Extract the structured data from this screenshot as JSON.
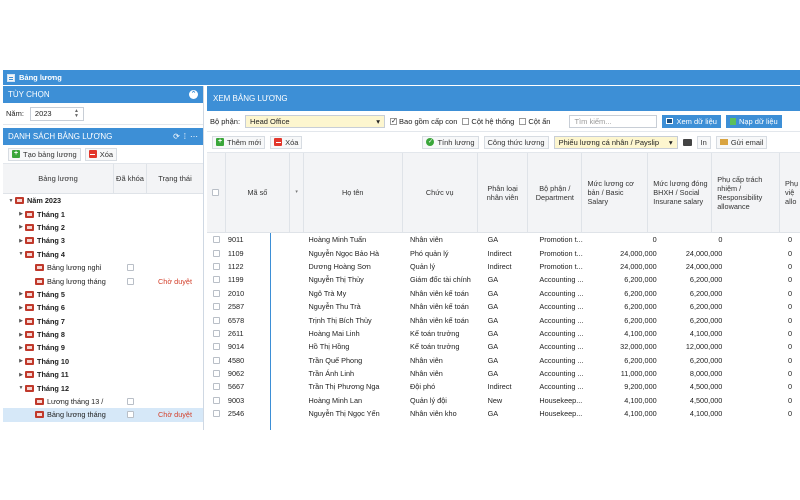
{
  "window": {
    "title": "Bảng lương"
  },
  "left_panel": {
    "options_title": "TÙY CHỌN",
    "year_label": "Năm:",
    "year_value": "2023",
    "list_title": "DANH SÁCH BẢNG LƯƠNG",
    "create_label": "Tạo bảng lương",
    "delete_label": "Xóa",
    "columns": [
      "Bảng lương",
      "Đã khóa",
      "Trạng thái"
    ],
    "tree": [
      {
        "label": "Năm 2023",
        "level": 0,
        "arrow": "down",
        "bold": true,
        "folder": true,
        "checkbox": false,
        "status": ""
      },
      {
        "label": "Tháng 1",
        "level": 1,
        "arrow": "right",
        "bold": true,
        "folder": true,
        "checkbox": false,
        "status": ""
      },
      {
        "label": "Tháng 2",
        "level": 1,
        "arrow": "right",
        "bold": true,
        "folder": true,
        "checkbox": false,
        "status": ""
      },
      {
        "label": "Tháng 3",
        "level": 1,
        "arrow": "right",
        "bold": true,
        "folder": true,
        "checkbox": false,
        "status": ""
      },
      {
        "label": "Tháng 4",
        "level": 1,
        "arrow": "down",
        "bold": true,
        "folder": true,
        "checkbox": false,
        "status": ""
      },
      {
        "label": "Bảng lương nghỉ",
        "level": 2,
        "arrow": "",
        "bold": false,
        "folder": true,
        "checkbox": true,
        "status": ""
      },
      {
        "label": "Bảng lương tháng",
        "level": 2,
        "arrow": "",
        "bold": false,
        "folder": true,
        "checkbox": true,
        "status": "Chờ duyệt"
      },
      {
        "label": "Tháng 5",
        "level": 1,
        "arrow": "right",
        "bold": true,
        "folder": true,
        "checkbox": false,
        "status": ""
      },
      {
        "label": "Tháng 6",
        "level": 1,
        "arrow": "right",
        "bold": true,
        "folder": true,
        "checkbox": false,
        "status": ""
      },
      {
        "label": "Tháng 7",
        "level": 1,
        "arrow": "right",
        "bold": true,
        "folder": true,
        "checkbox": false,
        "status": ""
      },
      {
        "label": "Tháng 8",
        "level": 1,
        "arrow": "right",
        "bold": true,
        "folder": true,
        "checkbox": false,
        "status": ""
      },
      {
        "label": "Tháng 9",
        "level": 1,
        "arrow": "right",
        "bold": true,
        "folder": true,
        "checkbox": false,
        "status": ""
      },
      {
        "label": "Tháng 10",
        "level": 1,
        "arrow": "right",
        "bold": true,
        "folder": true,
        "checkbox": false,
        "status": ""
      },
      {
        "label": "Tháng 11",
        "level": 1,
        "arrow": "right",
        "bold": true,
        "folder": true,
        "checkbox": false,
        "status": ""
      },
      {
        "label": "Tháng 12",
        "level": 1,
        "arrow": "down",
        "bold": true,
        "folder": true,
        "checkbox": false,
        "status": ""
      },
      {
        "label": "Lương tháng 13 /",
        "level": 2,
        "arrow": "",
        "bold": false,
        "folder": true,
        "checkbox": true,
        "status": ""
      },
      {
        "label": "Bảng lương tháng",
        "level": 2,
        "arrow": "",
        "bold": false,
        "folder": true,
        "checkbox": true,
        "status": "Chờ duyệt",
        "selected": true
      }
    ]
  },
  "right_panel": {
    "title": "XEM BẢNG LƯƠNG",
    "dept_label": "Bộ phận:",
    "dept_value": "Head Office",
    "include_children_label": "Bao gồm cấp con",
    "include_children_checked": true,
    "system_cols_label": "Cột hệ thống",
    "hidden_cols_label": "Cột ẩn",
    "search_placeholder": "Tìm kiếm...",
    "view_data_label": "Xem dữ liệu",
    "load_data_label": "Nạp dữ liệu",
    "add_label": "Thêm mới",
    "delete_label": "Xóa",
    "calc_label": "Tính lương",
    "formula_label": "Công thức lương",
    "payslip_value": "Phiếu lương cá nhân / Payslip",
    "print_label": "In",
    "email_label": "Gửi email",
    "columns": [
      "Mã số",
      "Họ tên",
      "Chức vụ",
      "Phân loại nhân viên",
      "Bộ phận / Department",
      "Mức lương cơ bản / Basic Salary",
      "Mức lương đóng BHXH / Social Insurane salary",
      "Phụ cấp trách nhiệm / Responsibility allowance",
      "Phụ việ allo"
    ],
    "rows": [
      {
        "code": "9011",
        "name": "Hoàng Minh Tuấn",
        "position": "Nhân viên",
        "type": "GA",
        "dept": "Promotion t...",
        "basic": "0",
        "insurance": "0",
        "allowance": "0"
      },
      {
        "code": "1109",
        "name": "Nguyễn Ngọc Bảo Hà",
        "position": "Phó quản lý",
        "type": "Indirect",
        "dept": "Promotion t...",
        "basic": "24,000,000",
        "insurance": "24,000,000",
        "allowance": "0"
      },
      {
        "code": "1122",
        "name": "Dương Hoàng Sơn",
        "position": "Quản lý",
        "type": "Indirect",
        "dept": "Promotion t...",
        "basic": "24,000,000",
        "insurance": "24,000,000",
        "allowance": "0"
      },
      {
        "code": "1199",
        "name": "Nguyễn Thị Thủy",
        "position": "Giám đốc tài chính",
        "type": "GA",
        "dept": "Accounting ...",
        "basic": "6,200,000",
        "insurance": "6,200,000",
        "allowance": "0"
      },
      {
        "code": "2010",
        "name": "Ngô Trà My",
        "position": "Nhân viên kế toán",
        "type": "GA",
        "dept": "Accounting ...",
        "basic": "6,200,000",
        "insurance": "6,200,000",
        "allowance": "0"
      },
      {
        "code": "2587",
        "name": "Nguyễn Thu Trà",
        "position": "Nhân viên kế toán",
        "type": "GA",
        "dept": "Accounting ...",
        "basic": "6,200,000",
        "insurance": "6,200,000",
        "allowance": "0"
      },
      {
        "code": "6578",
        "name": "Trịnh Thị Bích Thủy",
        "position": "Nhân viên kế toán",
        "type": "GA",
        "dept": "Accounting ...",
        "basic": "6,200,000",
        "insurance": "6,200,000",
        "allowance": "0"
      },
      {
        "code": "2611",
        "name": "Hoàng Mai Linh",
        "position": "Kế toán trưởng",
        "type": "GA",
        "dept": "Accounting ...",
        "basic": "4,100,000",
        "insurance": "4,100,000",
        "allowance": "0"
      },
      {
        "code": "9014",
        "name": "Hồ Thị Hồng",
        "position": "Kế toán trưởng",
        "type": "GA",
        "dept": "Accounting ...",
        "basic": "32,000,000",
        "insurance": "12,000,000",
        "allowance": "0"
      },
      {
        "code": "4580",
        "name": "Trần Quế Phong",
        "position": "Nhân viên",
        "type": "GA",
        "dept": "Accounting ...",
        "basic": "6,200,000",
        "insurance": "6,200,000",
        "allowance": "0"
      },
      {
        "code": "9062",
        "name": "Trần Ánh Linh",
        "position": "Nhân viên",
        "type": "GA",
        "dept": "Accounting ...",
        "basic": "11,000,000",
        "insurance": "8,000,000",
        "allowance": "0"
      },
      {
        "code": "5667",
        "name": "Trần Thị Phương Nga",
        "position": "Đội phó",
        "type": "Indirect",
        "dept": "Accounting ...",
        "basic": "9,200,000",
        "insurance": "4,500,000",
        "allowance": "0"
      },
      {
        "code": "9003",
        "name": "Hoàng Minh Lan",
        "position": "Quản lý đội",
        "type": "New",
        "dept": "Housekeep...",
        "basic": "4,100,000",
        "insurance": "4,500,000",
        "allowance": "0"
      },
      {
        "code": "2546",
        "name": "Nguyễn Thị Ngọc Yến",
        "position": "Nhân viên kho",
        "type": "GA",
        "dept": "Housekeep...",
        "basic": "4,100,000",
        "insurance": "4,100,000",
        "allowance": "0"
      }
    ]
  }
}
